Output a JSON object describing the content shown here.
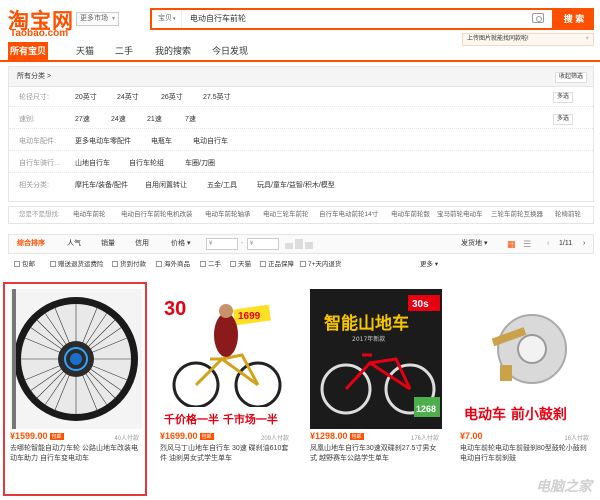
{
  "brand": {
    "name": "淘宝网",
    "sub": "Taobao.com"
  },
  "market_label": "更多市场",
  "search": {
    "scope": "宝贝",
    "query": "电动自行车前轮",
    "button": "搜 索"
  },
  "tip": "上传图片就能找同款啦!",
  "tabs": [
    "所有宝贝",
    "天猫",
    "二手",
    "我的搜索",
    "今日发现"
  ],
  "filter": {
    "header": "所有分类 >",
    "header_right": "收起筛选",
    "rows": [
      {
        "label": "轮径尺寸:",
        "values": [
          "20英寸",
          "24英寸",
          "26英寸",
          "27.5英寸"
        ],
        "more": "多选"
      },
      {
        "label": "速别:",
        "values": [
          "27速",
          "24速",
          "21速",
          "7速"
        ],
        "more": "多选"
      },
      {
        "label": "电动车配件:",
        "values": [
          "更多电动车零配件",
          "电瓶车",
          "电动自行车"
        ]
      },
      {
        "label": "自行车骑行...",
        "values": [
          "山地自行车",
          "自行车轮组",
          "车圈/刀圈"
        ]
      },
      {
        "label": "相关分类:",
        "values": [
          "摩托车/装备/配件",
          "自用闲置转让",
          "五金/工具",
          "玩具/童车/益智/积木/模型"
        ]
      }
    ]
  },
  "related": {
    "label": "您是不是想找:",
    "items": [
      "电动车前轮",
      "电动自行车前轮电机改装",
      "电动车前轮轴承",
      "电动三轮车前轮",
      "自行车电动前轮14寸",
      "电动车前轮毂",
      "宝马前轮电动车",
      "三轮车前轮互换器",
      "轮椅前轮"
    ]
  },
  "sort": {
    "items": [
      "综合排序",
      "人气",
      "销量",
      "信用",
      "价格"
    ],
    "price_from": "¥",
    "price_to": "¥",
    "ship_from": "发货地",
    "page": "1/11"
  },
  "options": [
    "包邮",
    "赠送退货运费险",
    "货到付款",
    "海外商品",
    "二手",
    "天猫",
    "正品保障",
    "7+天内退货"
  ],
  "options_more": "更多",
  "products": [
    {
      "price": "¥1599.00",
      "badge": "包邮",
      "sold": "40人付款",
      "title": "去哪轮智能自动力车轮 公路山地车改装电动车助力 自行车变电动车"
    },
    {
      "price": "¥1699.00",
      "badge": "包邮",
      "sold": "209人付款",
      "title": "烈风马丁山地车自行车 30速 碟刹油610套件 油刹男女式学生单车"
    },
    {
      "price": "¥1298.00",
      "badge": "包邮",
      "sold": "176人付款",
      "title": "凤凰山地车自行车30速双碟刹27.5寸男女式 越野赛车公路学生单车"
    },
    {
      "price": "¥7.00",
      "badge": "",
      "sold": "16人付款",
      "title": "电动车前轮电动车前鼓刹80型鼓轮小鼓刹电动自行车前刹鼓"
    }
  ],
  "promo": {
    "p1_num": "30",
    "p1_tag": "1699",
    "p1_bottom": "千价格一半  千市场一半",
    "p2_head": "智能山地车",
    "p2_year": "2017年新款",
    "p2_badge": "30s",
    "p2_price": "1268",
    "p3_text": "电动车 前小鼓刹"
  },
  "watermark": "电脑之家",
  "colors": {
    "accent": "#ff5000",
    "highlight": "#e4393c"
  }
}
